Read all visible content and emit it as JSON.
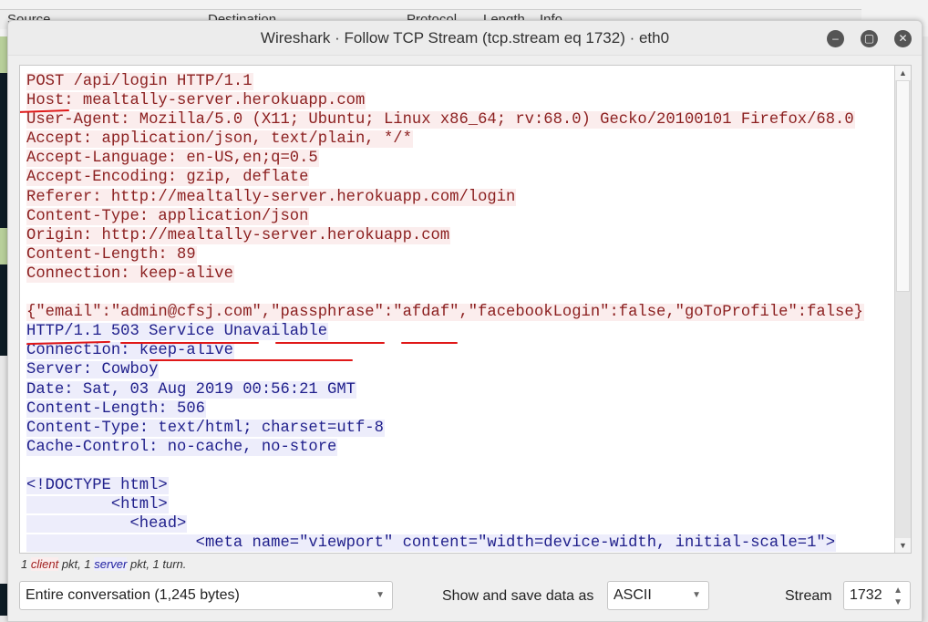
{
  "background": {
    "columns": [
      "Source",
      "Destination",
      "Protocol",
      "Length",
      "Info"
    ]
  },
  "window": {
    "title": "Wireshark · Follow TCP Stream (tcp.stream eq 1732) · eth0",
    "minimize": "–",
    "maximize": "▢",
    "close": "✕"
  },
  "stream": {
    "lines": [
      {
        "side": "client",
        "text": "POST /api/login HTTP/1.1"
      },
      {
        "side": "client",
        "text": "Host: mealtally-server.herokuapp.com"
      },
      {
        "side": "client",
        "text": "User-Agent: Mozilla/5.0 (X11; Ubuntu; Linux x86_64; rv:68.0) Gecko/20100101 Firefox/68.0"
      },
      {
        "side": "client",
        "text": "Accept: application/json, text/plain, */*"
      },
      {
        "side": "client",
        "text": "Accept-Language: en-US,en;q=0.5"
      },
      {
        "side": "client",
        "text": "Accept-Encoding: gzip, deflate"
      },
      {
        "side": "client",
        "text": "Referer: http://mealtally-server.herokuapp.com/login"
      },
      {
        "side": "client",
        "text": "Content-Type: application/json"
      },
      {
        "side": "client",
        "text": "Origin: http://mealtally-server.herokuapp.com"
      },
      {
        "side": "client",
        "text": "Content-Length: 89"
      },
      {
        "side": "client",
        "text": "Connection: keep-alive"
      },
      {
        "side": "blank",
        "text": ""
      },
      {
        "side": "client",
        "text": "{\"email\":\"admin@cfsj.com\",\"passphrase\":\"afdaf\",\"facebookLogin\":false,\"goToProfile\":false}"
      },
      {
        "side": "server",
        "text": "HTTP/1.1 503 Service Unavailable"
      },
      {
        "side": "server",
        "text": "Connection: keep-alive"
      },
      {
        "side": "server",
        "text": "Server: Cowboy"
      },
      {
        "side": "server",
        "text": "Date: Sat, 03 Aug 2019 00:56:21 GMT"
      },
      {
        "side": "server",
        "text": "Content-Length: 506"
      },
      {
        "side": "server",
        "text": "Content-Type: text/html; charset=utf-8"
      },
      {
        "side": "server",
        "text": "Cache-Control: no-cache, no-store"
      },
      {
        "side": "blank",
        "text": ""
      },
      {
        "side": "server",
        "text": "<!DOCTYPE html>"
      },
      {
        "side": "server",
        "text": "         <html>"
      },
      {
        "side": "server",
        "text": "           <head>"
      },
      {
        "side": "server",
        "text": "                  <meta name=\"viewport\" content=\"width=device-width, initial-scale=1\">"
      }
    ]
  },
  "status": {
    "n1": "1 ",
    "client": "client",
    "mid": " pkt, 1 ",
    "server": "server",
    "end": " pkt, 1 turn."
  },
  "controls": {
    "conversation": "Entire conversation (1,245 bytes)",
    "show_save_label": "Show and save data as",
    "format": "ASCII",
    "stream_label": "Stream",
    "stream_value": "1732"
  },
  "colors": {
    "client_bg": "#fbeded",
    "client_fg": "#8b1f1f",
    "server_bg": "#ededfb",
    "server_fg": "#1f1f8b",
    "annotation": "#e01818"
  }
}
